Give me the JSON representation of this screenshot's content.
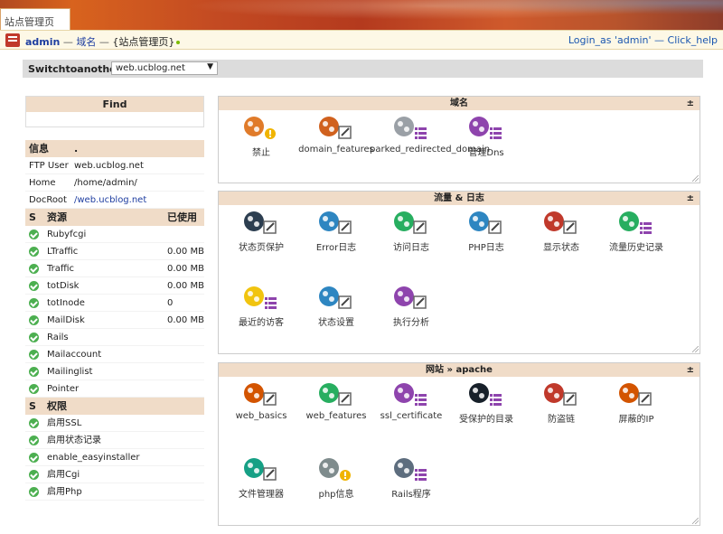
{
  "tab": {
    "label": "站点管理页"
  },
  "adminbar": {
    "user": "admin",
    "sep1": " — ",
    "domain_link": "域名",
    "sep2": " — ",
    "page": "{站点管理页}",
    "login_as": "Login_as 'admin' — Click_help"
  },
  "switch": {
    "label": "Switchtoanother",
    "selected": "web.ucblog.net"
  },
  "find": {
    "title": "Find"
  },
  "info": {
    "header": [
      "信息",
      "."
    ],
    "rows": [
      {
        "k": "FTP User",
        "v": "web.ucblog.net"
      },
      {
        "k": "Home",
        "v": "/home/admin/"
      },
      {
        "k": "DocRoot",
        "v": "/web.ucblog.net"
      }
    ]
  },
  "resources": {
    "header": [
      "S",
      "资源",
      "已使用"
    ],
    "rows": [
      {
        "name": "Rubyfcgi",
        "used": ""
      },
      {
        "name": "LTraffic",
        "used": "0.00 MB"
      },
      {
        "name": "Traffic",
        "used": "0.00 MB"
      },
      {
        "name": "totDisk",
        "used": "0.00 MB"
      },
      {
        "name": "totInode",
        "used": "0"
      },
      {
        "name": "MailDisk",
        "used": "0.00 MB"
      },
      {
        "name": "Rails",
        "used": ""
      },
      {
        "name": "Mailaccount",
        "used": ""
      },
      {
        "name": "Mailinglist",
        "used": ""
      },
      {
        "name": "Pointer",
        "used": ""
      }
    ]
  },
  "perms": {
    "header": [
      "S",
      "权限"
    ],
    "rows": [
      "启用SSL",
      "启用状态记录",
      "enable_easyinstaller",
      "启用Cgi",
      "启用Php"
    ]
  },
  "panels": [
    {
      "title": "域名",
      "toggle": "±",
      "items": [
        "禁止",
        "domain_features",
        "parked_redirected_domain",
        "管理Dns"
      ]
    },
    {
      "title": "流量 & 日志",
      "toggle": "±",
      "items": [
        "状态页保护",
        "Error日志",
        "访问日志",
        "PHP日志",
        "显示状态",
        "流量历史记录",
        "最近的访客",
        "状态设置",
        "执行分析"
      ]
    },
    {
      "title": "网站 » apache",
      "toggle": "±",
      "items": [
        "web_basics",
        "web_features",
        "ssl_certificate",
        "受保护的目录",
        "防盗链",
        "屏蔽的IP",
        "文件管理器",
        "php信息",
        "Rails程序"
      ]
    }
  ],
  "colors": {
    "header_bg": "#f0dcc8",
    "link": "#1f3ea0",
    "ok_green": "#4caf50"
  }
}
